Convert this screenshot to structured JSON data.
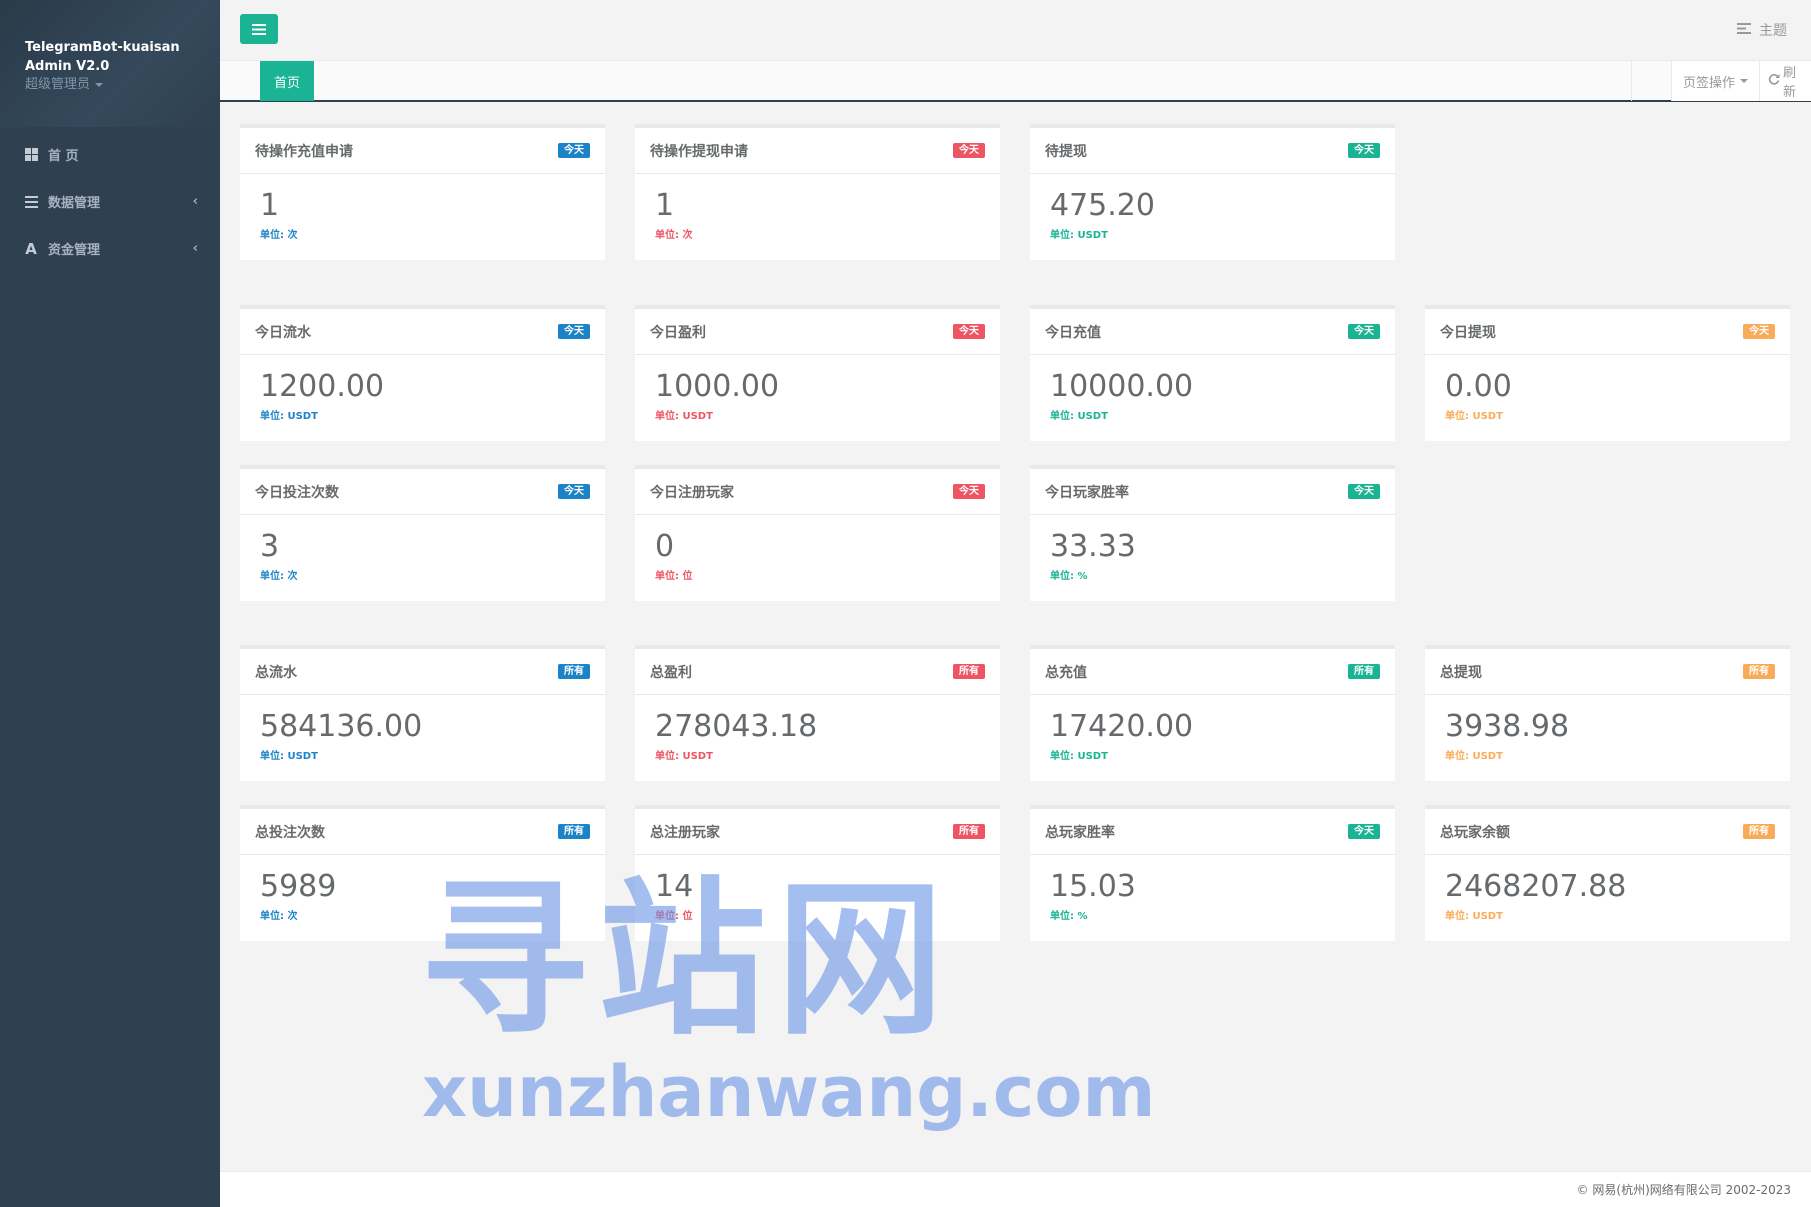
{
  "sidebar": {
    "brand_line1": "TelegramBot-kuaisan",
    "brand_line2": "Admin V2.0",
    "role": "超级管理员",
    "items": [
      {
        "label": "首 页",
        "icon": "dashboard-icon"
      },
      {
        "label": "数据管理",
        "icon": "list-icon"
      },
      {
        "label": "资金管理",
        "icon": "font-a-icon"
      }
    ]
  },
  "topbar": {
    "theme_label": "主题"
  },
  "tabs": {
    "active_label": "首页",
    "ops_label": "页签操作",
    "refresh_label": "刷新"
  },
  "cards": [
    {
      "title": "待操作充值申请",
      "badge": "今天",
      "value": "1",
      "unit": "单位: 次",
      "color": "#1c84c6"
    },
    {
      "title": "待操作提现申请",
      "badge": "今天",
      "value": "1",
      "unit": "单位: 次",
      "color": "#ed5565"
    },
    {
      "title": "待提现",
      "badge": "今天",
      "value": "475.20",
      "unit": "单位: USDT",
      "color": "#1ab394"
    },
    {
      "title": "今日流水",
      "badge": "今天",
      "value": "1200.00",
      "unit": "单位: USDT",
      "color": "#1c84c6"
    },
    {
      "title": "今日盈利",
      "badge": "今天",
      "value": "1000.00",
      "unit": "单位: USDT",
      "color": "#ed5565"
    },
    {
      "title": "今日充值",
      "badge": "今天",
      "value": "10000.00",
      "unit": "单位: USDT",
      "color": "#1ab394"
    },
    {
      "title": "今日提现",
      "badge": "今天",
      "value": "0.00",
      "unit": "单位: USDT",
      "color": "#f8ac59"
    },
    {
      "title": "今日投注次数",
      "badge": "今天",
      "value": "3",
      "unit": "单位: 次",
      "color": "#1c84c6"
    },
    {
      "title": "今日注册玩家",
      "badge": "今天",
      "value": "0",
      "unit": "单位: 位",
      "color": "#ed5565"
    },
    {
      "title": "今日玩家胜率",
      "badge": "今天",
      "value": "33.33",
      "unit": "单位: %",
      "color": "#1ab394"
    },
    {
      "title": "总流水",
      "badge": "所有",
      "value": "584136.00",
      "unit": "单位: USDT",
      "color": "#1c84c6"
    },
    {
      "title": "总盈利",
      "badge": "所有",
      "value": "278043.18",
      "unit": "单位: USDT",
      "color": "#ed5565"
    },
    {
      "title": "总充值",
      "badge": "所有",
      "value": "17420.00",
      "unit": "单位: USDT",
      "color": "#1ab394"
    },
    {
      "title": "总提现",
      "badge": "所有",
      "value": "3938.98",
      "unit": "单位: USDT",
      "color": "#f8ac59"
    },
    {
      "title": "总投注次数",
      "badge": "所有",
      "value": "5989",
      "unit": "单位: 次",
      "color": "#1c84c6"
    },
    {
      "title": "总注册玩家",
      "badge": "所有",
      "value": "14",
      "unit": "单位: 位",
      "color": "#ed5565"
    },
    {
      "title": "总玩家胜率",
      "badge": "今天",
      "value": "15.03",
      "unit": "单位: %",
      "color": "#1ab394"
    },
    {
      "title": "总玩家余额",
      "badge": "所有",
      "value": "2468207.88",
      "unit": "单位: USDT",
      "color": "#f8ac59"
    }
  ],
  "watermark": {
    "main": "寻站网",
    "sub": "xunzhanwang.com"
  },
  "footer": {
    "copyright": "© 网易(杭州)网络有限公司 2002-2023"
  }
}
